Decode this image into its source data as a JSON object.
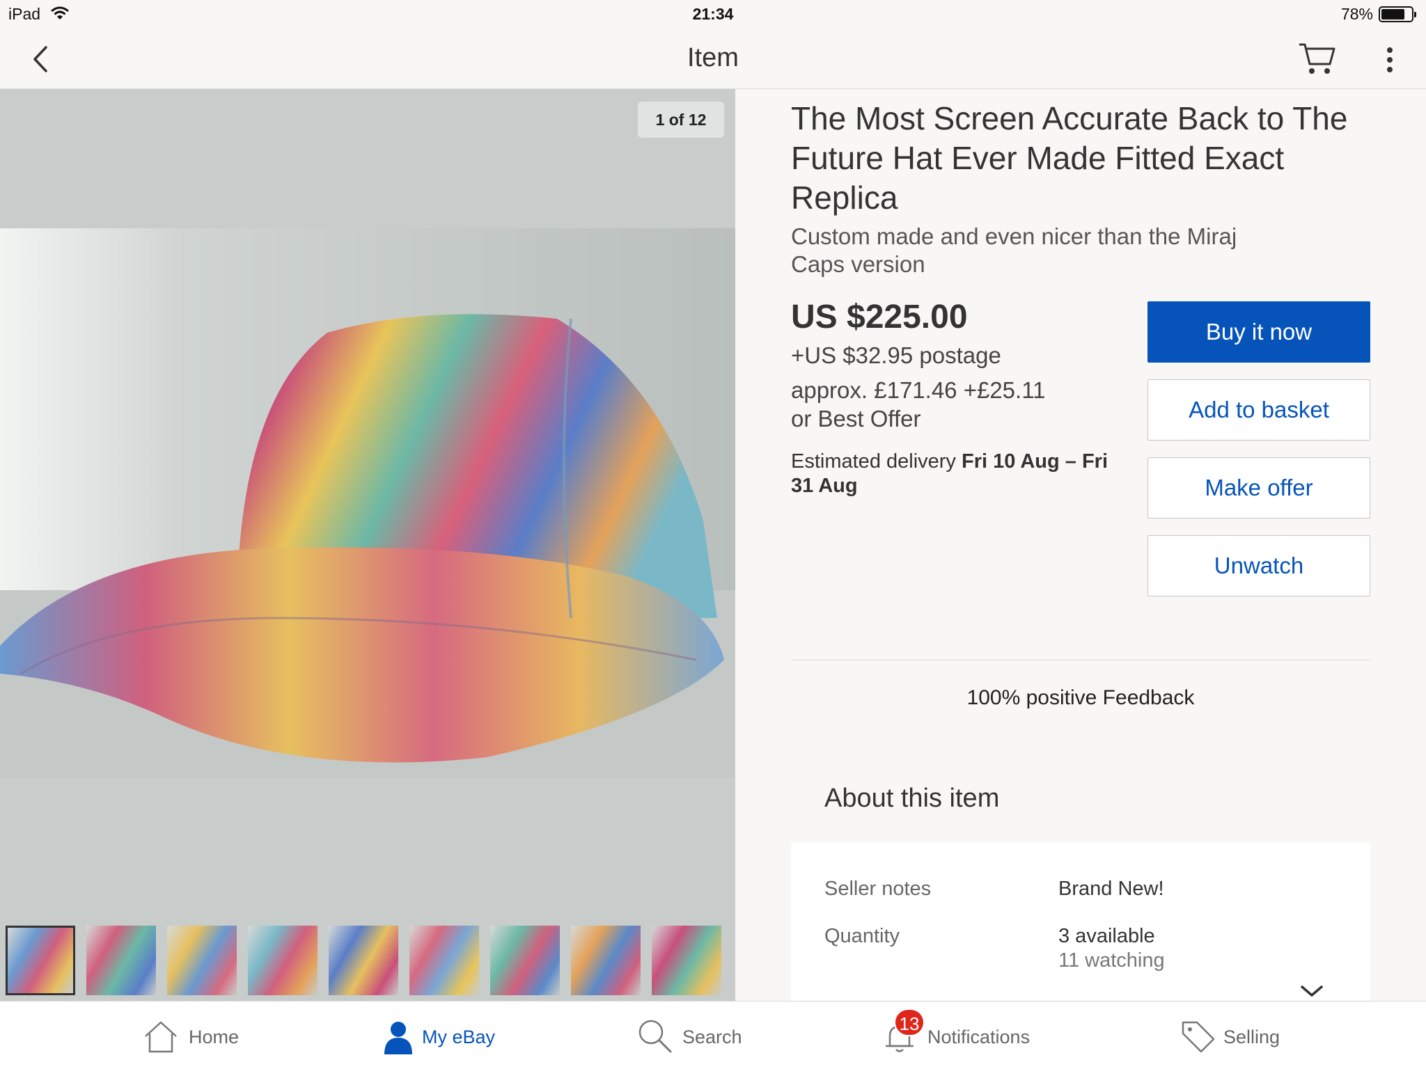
{
  "status_bar": {
    "device": "iPad",
    "time": "21:34",
    "battery_percent": "78%",
    "battery_level": 0.78
  },
  "nav": {
    "title": "Item",
    "back_icon": "chevron-left-icon",
    "cart_icon": "cart-icon",
    "more_icon": "more-vertical-icon"
  },
  "gallery": {
    "counter": "1 of 12",
    "selected_thumbnail": 1,
    "thumbnail_count": 9
  },
  "item": {
    "title": "The Most Screen Accurate Back to The Future Hat Ever Made Fitted Exact Replica",
    "subtitle": "Custom made and even nicer than the Miraj Caps version",
    "price": "US $225.00",
    "postage": "+US $32.95 postage",
    "approx": "approx. £171.46 +£25.11",
    "best_offer": "or Best Offer",
    "delivery_label": "Estimated delivery",
    "delivery_dates": "Fri 10 Aug – Fri 31 Aug"
  },
  "actions": {
    "buy_now": "Buy it now",
    "add_to_basket": "Add to basket",
    "make_offer": "Make offer",
    "unwatch": "Unwatch"
  },
  "seller": {
    "feedback": "100% positive Feedback"
  },
  "about": {
    "heading": "About this item",
    "rows": [
      {
        "label": "Seller notes",
        "value": "Brand New!"
      },
      {
        "label": "Quantity",
        "value": "3 available",
        "value2": "11 watching"
      }
    ]
  },
  "tabbar": {
    "items": [
      {
        "label": "Home",
        "icon": "home-icon"
      },
      {
        "label": "My eBay",
        "icon": "person-icon"
      },
      {
        "label": "Search",
        "icon": "search-icon"
      },
      {
        "label": "Notifications",
        "icon": "bell-icon",
        "badge": "13"
      },
      {
        "label": "Selling",
        "icon": "tag-icon"
      }
    ],
    "active": "My eBay"
  },
  "colors": {
    "accent": "#0654ba",
    "badge": "#e0261b"
  }
}
